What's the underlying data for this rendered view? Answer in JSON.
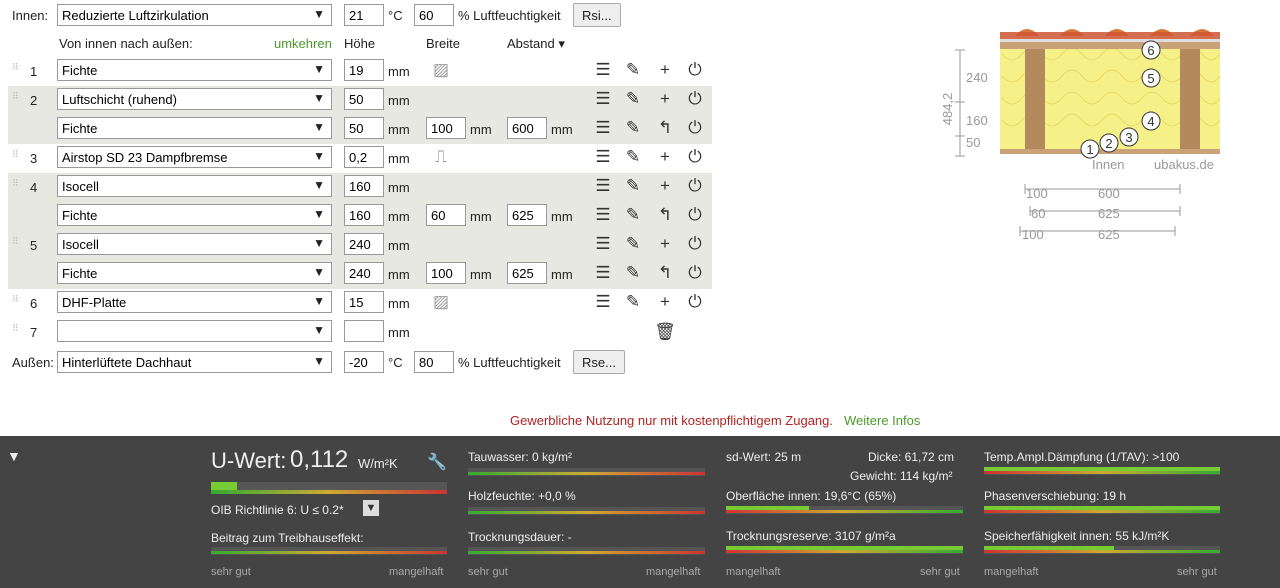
{
  "innen": {
    "label": "Innen:",
    "climate": "Reduzierte Luftzirkulation",
    "temp": "21",
    "temp_unit": "°C",
    "humidity": "60",
    "humidity_unit": "% Luftfeuchtigkeit",
    "rsi": "Rsi..."
  },
  "header": {
    "direction": "Von innen nach außen:",
    "reverse": "umkehren",
    "hoehe": "Höhe",
    "breite": "Breite",
    "abstand": "Abstand ▾"
  },
  "unit_mm": "mm",
  "layers": [
    {
      "num": "1",
      "material": "Fichte",
      "thick": "19"
    },
    {
      "num": "2",
      "material": "Luftschicht (ruhend)",
      "thick": "50",
      "sub": {
        "material": "Fichte",
        "thick": "50",
        "width": "100",
        "spacing": "600"
      }
    },
    {
      "num": "3",
      "material": "Airstop SD 23 Dampfbremse",
      "thick": "0,2"
    },
    {
      "num": "4",
      "material": "Isocell",
      "thick": "160",
      "sub": {
        "material": "Fichte",
        "thick": "160",
        "width": "60",
        "spacing": "625"
      }
    },
    {
      "num": "5",
      "material": "Isocell",
      "thick": "240",
      "sub": {
        "material": "Fichte",
        "thick": "240",
        "width": "100",
        "spacing": "625"
      }
    },
    {
      "num": "6",
      "material": "DHF-Platte",
      "thick": "15"
    },
    {
      "num": "7",
      "material": "",
      "thick": ""
    }
  ],
  "aussen": {
    "label": "Außen:",
    "climate": "Hinterlüftete Dachhaut",
    "temp": "-20",
    "temp_unit": "°C",
    "humidity": "80",
    "humidity_unit": "% Luftfeuchtigkeit",
    "rse": "Rse..."
  },
  "diagram": {
    "total": "484,2",
    "d240": "240",
    "d160": "160",
    "d50": "50",
    "innen": "Innen",
    "brand": "ubakus.de",
    "nums": [
      "1",
      "2",
      "3",
      "4",
      "5",
      "6"
    ],
    "dims": [
      {
        "a": "100",
        "b": "600"
      },
      {
        "a": "60",
        "b": "625"
      },
      {
        "a": "100",
        "b": "625"
      }
    ]
  },
  "notice": {
    "text": "Gewerbliche Nutzung nur mit kostenpflichtigem Zugang.",
    "link": "Weitere Infos"
  },
  "results": {
    "toggle": "▼",
    "uwert_label": "U-Wert:",
    "uwert_value": "0,112",
    "uwert_unit": "W/m²K",
    "uwert_fill": 0.11,
    "oib": "OIB Richtlinie 6: U ≤ 0.2*",
    "beitrag": "Beitrag zum Treibhauseffekt:",
    "sehr_gut": "sehr gut",
    "mangelhaft": "mangelhaft",
    "tauwasser": "Tauwasser: 0 kg/m²",
    "holzfeuchte": "Holzfeuchte: +0,0 %",
    "trocknungsdauer": "Trocknungsdauer: -",
    "sdwert": "sd-Wert: 25 m",
    "dicke": "Dicke: 61,72 cm",
    "gewicht": "Gewicht: 114 kg/m²",
    "oberflaeche": "Oberfläche innen: 19,6°C (65%)",
    "oberflaeche_fill": 0.35,
    "trocknungsreserve": "Trocknungsreserve: 3107 g/m²a",
    "trocknungsreserve_fill": 1.0,
    "tav": "Temp.Ampl.Dämpfung (1/TAV): >100",
    "tav_fill": 1.0,
    "phase": "Phasenverschiebung: 19 h",
    "phase_fill": 1.0,
    "speicher": "Speicherfähigkeit innen: 55 kJ/m²K",
    "speicher_fill": 0.55
  },
  "colors": {
    "band": "#e8e8e2",
    "footer": "#444444",
    "accent": "#4a9a2a",
    "notice": "#b22222"
  }
}
